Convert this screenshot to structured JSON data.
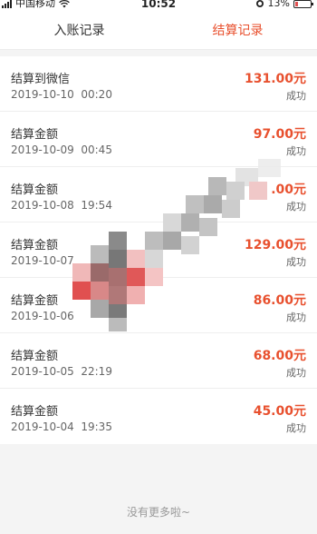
{
  "status_bar": {
    "carrier": "中国移动",
    "time": "10:52",
    "battery": "13%"
  },
  "tabs": [
    {
      "label": "入账记录",
      "active": false
    },
    {
      "label": "结算记录",
      "active": true
    }
  ],
  "records": [
    {
      "title": "结算到微信",
      "date": "2019-10-10  00:20",
      "amount": "131.00元",
      "status": "成功"
    },
    {
      "title": "结算金额",
      "date": "2019-10-09  00:45",
      "amount": "97.00元",
      "status": "成功"
    },
    {
      "title": "结算金额",
      "date": "2019-10-08  19:54",
      "amount": ".00元",
      "status": "成功"
    },
    {
      "title": "结算金额",
      "date": "2019-10-07",
      "amount": "129.00元",
      "status": "成功"
    },
    {
      "title": "结算金额",
      "date": "2019-10-06",
      "amount": "86.00元",
      "status": "成功"
    },
    {
      "title": "结算金额",
      "date": "2019-10-05  22:19",
      "amount": "68.00元",
      "status": "成功"
    },
    {
      "title": "结算金额",
      "date": "2019-10-04  19:35",
      "amount": "45.00元",
      "status": "成功"
    }
  ],
  "footer": {
    "text": "没有更多啦~"
  },
  "colors": {
    "accent": "#e8502e",
    "background": "#f4f4f4"
  }
}
